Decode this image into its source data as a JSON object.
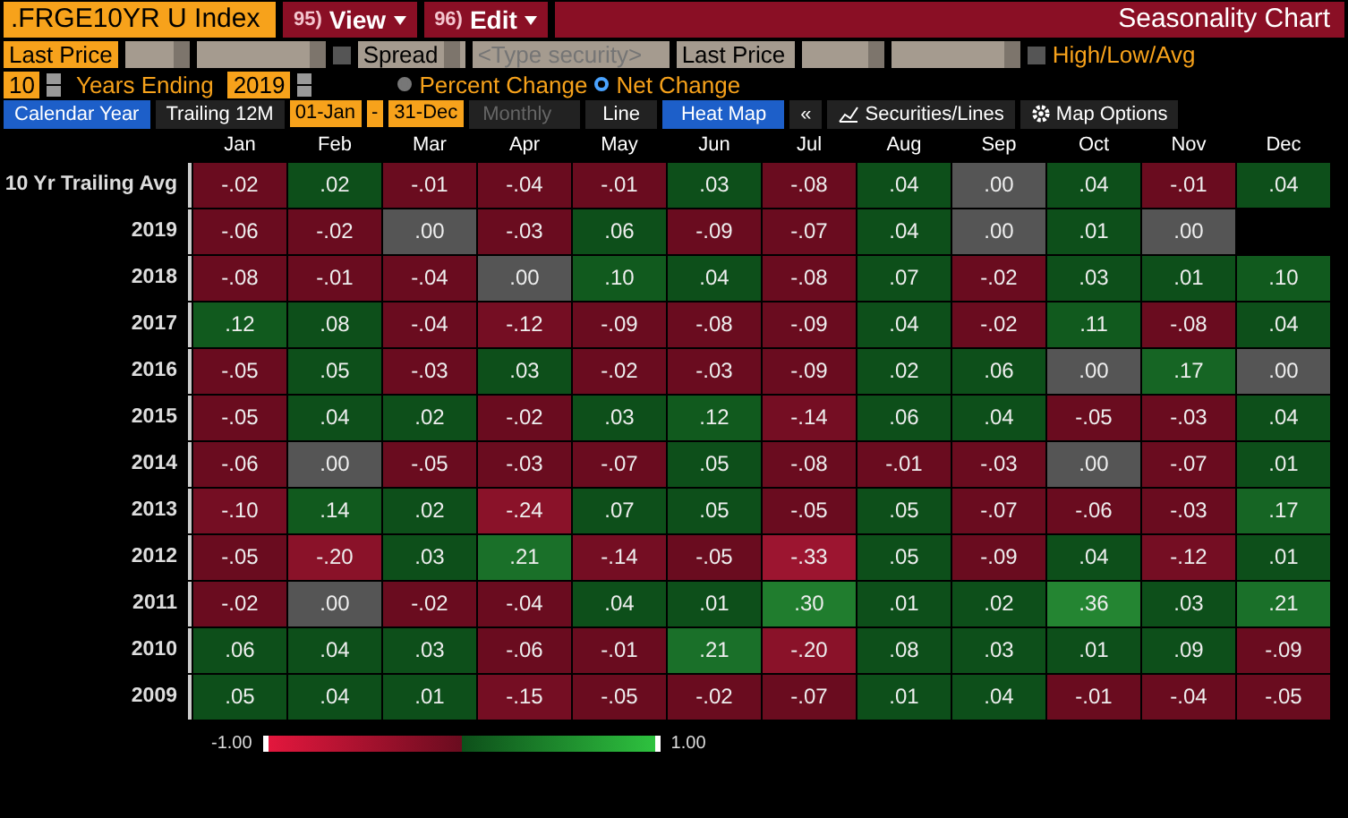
{
  "header": {
    "security": ".FRGE10YR U Index",
    "menus": [
      {
        "num": "95)",
        "label": "View"
      },
      {
        "num": "96)",
        "label": "Edit"
      }
    ],
    "title": "Seasonality Chart"
  },
  "inputs": {
    "field1": "Last Price",
    "spread": "Spread",
    "security_placeholder": "<Type security>",
    "field2": "Last Price",
    "compare_checked": false,
    "hla_checked": false,
    "hla_label": "High/Low/Avg"
  },
  "range": {
    "years": "10",
    "years_label": "Years Ending",
    "end_year": "2019",
    "modes": [
      {
        "label": "Percent Change",
        "selected": false
      },
      {
        "label": "Net Change",
        "selected": true
      }
    ]
  },
  "period_tabs": [
    {
      "label": "Calendar Year",
      "selected": true
    },
    {
      "label": "Trailing 12M",
      "selected": false
    }
  ],
  "dates": {
    "start": "01-Jan",
    "sep": "-",
    "end": "31-Dec"
  },
  "frequency": {
    "label": "Monthly",
    "disabled": true
  },
  "view_tabs": [
    {
      "label": "Line",
      "selected": false
    },
    {
      "label": "Heat Map",
      "selected": true
    }
  ],
  "tools": {
    "collapse": "«",
    "securities": "Securities/Lines",
    "options": "Map Options"
  },
  "months": [
    "Jan",
    "Feb",
    "Mar",
    "Apr",
    "May",
    "Jun",
    "Jul",
    "Aug",
    "Sep",
    "Oct",
    "Nov",
    "Dec"
  ],
  "rows": [
    {
      "label": "10 Yr Trailing Avg",
      "cells": [
        {
          "v": "-.02",
          "color": "#6a0c1f"
        },
        {
          "v": ".02",
          "color": "#0d4f1a"
        },
        {
          "v": "-.01",
          "color": "#6a0c1f"
        },
        {
          "v": "-.04",
          "color": "#6a0c1f"
        },
        {
          "v": "-.01",
          "color": "#6a0c1f"
        },
        {
          "v": ".03",
          "color": "#0d4f1a"
        },
        {
          "v": "-.08",
          "color": "#6a0c1f"
        },
        {
          "v": ".04",
          "color": "#0d4f1a"
        },
        {
          "v": ".00",
          "color": "#555555"
        },
        {
          "v": ".04",
          "color": "#0d4f1a"
        },
        {
          "v": "-.01",
          "color": "#6a0c1f"
        },
        {
          "v": ".04",
          "color": "#0d4f1a"
        }
      ]
    },
    {
      "label": "2019",
      "cells": [
        {
          "v": "-.06",
          "color": "#6a0c1f"
        },
        {
          "v": "-.02",
          "color": "#6a0c1f"
        },
        {
          "v": ".00",
          "color": "#555555"
        },
        {
          "v": "-.03",
          "color": "#6a0c1f"
        },
        {
          "v": ".06",
          "color": "#0d4f1a"
        },
        {
          "v": "-.09",
          "color": "#6a0c1f"
        },
        {
          "v": "-.07",
          "color": "#6a0c1f"
        },
        {
          "v": ".04",
          "color": "#0d4f1a"
        },
        {
          "v": ".00",
          "color": "#555555"
        },
        {
          "v": ".01",
          "color": "#0d4f1a"
        },
        {
          "v": ".00",
          "color": "#555555"
        }
      ]
    },
    {
      "label": "2018",
      "cells": [
        {
          "v": "-.08",
          "color": "#6a0c1f"
        },
        {
          "v": "-.01",
          "color": "#6a0c1f"
        },
        {
          "v": "-.04",
          "color": "#6a0c1f"
        },
        {
          "v": ".00",
          "color": "#555555"
        },
        {
          "v": ".10",
          "color": "#115a1e"
        },
        {
          "v": ".04",
          "color": "#0d4f1a"
        },
        {
          "v": "-.08",
          "color": "#6a0c1f"
        },
        {
          "v": ".07",
          "color": "#0d4f1a"
        },
        {
          "v": "-.02",
          "color": "#6a0c1f"
        },
        {
          "v": ".03",
          "color": "#0d4f1a"
        },
        {
          "v": ".01",
          "color": "#0d4f1a"
        },
        {
          "v": ".10",
          "color": "#115a1e"
        }
      ]
    },
    {
      "label": "2017",
      "cells": [
        {
          "v": ".12",
          "color": "#115a1e"
        },
        {
          "v": ".08",
          "color": "#0d4f1a"
        },
        {
          "v": "-.04",
          "color": "#6a0c1f"
        },
        {
          "v": "-.12",
          "color": "#750e23"
        },
        {
          "v": "-.09",
          "color": "#6a0c1f"
        },
        {
          "v": "-.08",
          "color": "#6a0c1f"
        },
        {
          "v": "-.09",
          "color": "#6a0c1f"
        },
        {
          "v": ".04",
          "color": "#0d4f1a"
        },
        {
          "v": "-.02",
          "color": "#6a0c1f"
        },
        {
          "v": ".11",
          "color": "#115a1e"
        },
        {
          "v": "-.08",
          "color": "#6a0c1f"
        },
        {
          "v": ".04",
          "color": "#0d4f1a"
        }
      ]
    },
    {
      "label": "2016",
      "cells": [
        {
          "v": "-.05",
          "color": "#6a0c1f"
        },
        {
          "v": ".05",
          "color": "#0d4f1a"
        },
        {
          "v": "-.03",
          "color": "#6a0c1f"
        },
        {
          "v": ".03",
          "color": "#0d4f1a"
        },
        {
          "v": "-.02",
          "color": "#6a0c1f"
        },
        {
          "v": "-.03",
          "color": "#6a0c1f"
        },
        {
          "v": "-.09",
          "color": "#6a0c1f"
        },
        {
          "v": ".02",
          "color": "#0d4f1a"
        },
        {
          "v": ".06",
          "color": "#0d4f1a"
        },
        {
          "v": ".00",
          "color": "#555555"
        },
        {
          "v": ".17",
          "color": "#166524"
        },
        {
          "v": ".00",
          "color": "#555555"
        }
      ]
    },
    {
      "label": "2015",
      "cells": [
        {
          "v": "-.05",
          "color": "#6a0c1f"
        },
        {
          "v": ".04",
          "color": "#0d4f1a"
        },
        {
          "v": ".02",
          "color": "#0d4f1a"
        },
        {
          "v": "-.02",
          "color": "#6a0c1f"
        },
        {
          "v": ".03",
          "color": "#0d4f1a"
        },
        {
          "v": ".12",
          "color": "#115a1e"
        },
        {
          "v": "-.14",
          "color": "#750e23"
        },
        {
          "v": ".06",
          "color": "#0d4f1a"
        },
        {
          "v": ".04",
          "color": "#0d4f1a"
        },
        {
          "v": "-.05",
          "color": "#6a0c1f"
        },
        {
          "v": "-.03",
          "color": "#6a0c1f"
        },
        {
          "v": ".04",
          "color": "#0d4f1a"
        }
      ]
    },
    {
      "label": "2014",
      "cells": [
        {
          "v": "-.06",
          "color": "#6a0c1f"
        },
        {
          "v": ".00",
          "color": "#555555"
        },
        {
          "v": "-.05",
          "color": "#6a0c1f"
        },
        {
          "v": "-.03",
          "color": "#6a0c1f"
        },
        {
          "v": "-.07",
          "color": "#6a0c1f"
        },
        {
          "v": ".05",
          "color": "#0d4f1a"
        },
        {
          "v": "-.08",
          "color": "#6a0c1f"
        },
        {
          "v": "-.01",
          "color": "#6a0c1f"
        },
        {
          "v": "-.03",
          "color": "#6a0c1f"
        },
        {
          "v": ".00",
          "color": "#555555"
        },
        {
          "v": "-.07",
          "color": "#6a0c1f"
        },
        {
          "v": ".01",
          "color": "#0d4f1a"
        }
      ]
    },
    {
      "label": "2013",
      "cells": [
        {
          "v": "-.10",
          "color": "#750e23"
        },
        {
          "v": ".14",
          "color": "#115a1e"
        },
        {
          "v": ".02",
          "color": "#0d4f1a"
        },
        {
          "v": "-.24",
          "color": "#8a1229"
        },
        {
          "v": ".07",
          "color": "#0d4f1a"
        },
        {
          "v": ".05",
          "color": "#0d4f1a"
        },
        {
          "v": "-.05",
          "color": "#6a0c1f"
        },
        {
          "v": ".05",
          "color": "#0d4f1a"
        },
        {
          "v": "-.07",
          "color": "#6a0c1f"
        },
        {
          "v": "-.06",
          "color": "#6a0c1f"
        },
        {
          "v": "-.03",
          "color": "#6a0c1f"
        },
        {
          "v": ".17",
          "color": "#166524"
        }
      ]
    },
    {
      "label": "2012",
      "cells": [
        {
          "v": "-.05",
          "color": "#6a0c1f"
        },
        {
          "v": "-.20",
          "color": "#8a1229"
        },
        {
          "v": ".03",
          "color": "#0d4f1a"
        },
        {
          "v": ".21",
          "color": "#1a7029"
        },
        {
          "v": "-.14",
          "color": "#750e23"
        },
        {
          "v": "-.05",
          "color": "#6a0c1f"
        },
        {
          "v": "-.33",
          "color": "#9c1530"
        },
        {
          "v": ".05",
          "color": "#0d4f1a"
        },
        {
          "v": "-.09",
          "color": "#6a0c1f"
        },
        {
          "v": ".04",
          "color": "#0d4f1a"
        },
        {
          "v": "-.12",
          "color": "#750e23"
        },
        {
          "v": ".01",
          "color": "#0d4f1a"
        }
      ]
    },
    {
      "label": "2011",
      "cells": [
        {
          "v": "-.02",
          "color": "#6a0c1f"
        },
        {
          "v": ".00",
          "color": "#555555"
        },
        {
          "v": "-.02",
          "color": "#6a0c1f"
        },
        {
          "v": "-.04",
          "color": "#6a0c1f"
        },
        {
          "v": ".04",
          "color": "#0d4f1a"
        },
        {
          "v": ".01",
          "color": "#0d4f1a"
        },
        {
          "v": ".30",
          "color": "#207d2e"
        },
        {
          "v": ".01",
          "color": "#0d4f1a"
        },
        {
          "v": ".02",
          "color": "#0d4f1a"
        },
        {
          "v": ".36",
          "color": "#248532"
        },
        {
          "v": ".03",
          "color": "#0d4f1a"
        },
        {
          "v": ".21",
          "color": "#1a7029"
        }
      ]
    },
    {
      "label": "2010",
      "cells": [
        {
          "v": ".06",
          "color": "#0d4f1a"
        },
        {
          "v": ".04",
          "color": "#0d4f1a"
        },
        {
          "v": ".03",
          "color": "#0d4f1a"
        },
        {
          "v": "-.06",
          "color": "#6a0c1f"
        },
        {
          "v": "-.01",
          "color": "#6a0c1f"
        },
        {
          "v": ".21",
          "color": "#1a7029"
        },
        {
          "v": "-.20",
          "color": "#8a1229"
        },
        {
          "v": ".08",
          "color": "#0d4f1a"
        },
        {
          "v": ".03",
          "color": "#0d4f1a"
        },
        {
          "v": ".01",
          "color": "#0d4f1a"
        },
        {
          "v": ".09",
          "color": "#0d4f1a"
        },
        {
          "v": "-.09",
          "color": "#6a0c1f"
        }
      ]
    },
    {
      "label": "2009",
      "cells": [
        {
          "v": ".05",
          "color": "#0d4f1a"
        },
        {
          "v": ".04",
          "color": "#0d4f1a"
        },
        {
          "v": ".01",
          "color": "#0d4f1a"
        },
        {
          "v": "-.15",
          "color": "#750e23"
        },
        {
          "v": "-.05",
          "color": "#6a0c1f"
        },
        {
          "v": "-.02",
          "color": "#6a0c1f"
        },
        {
          "v": "-.07",
          "color": "#6a0c1f"
        },
        {
          "v": ".01",
          "color": "#0d4f1a"
        },
        {
          "v": ".04",
          "color": "#0d4f1a"
        },
        {
          "v": "-.01",
          "color": "#6a0c1f"
        },
        {
          "v": "-.04",
          "color": "#6a0c1f"
        },
        {
          "v": "-.05",
          "color": "#6a0c1f"
        }
      ]
    }
  ],
  "legend": {
    "min": "-1.00",
    "max": "1.00"
  }
}
